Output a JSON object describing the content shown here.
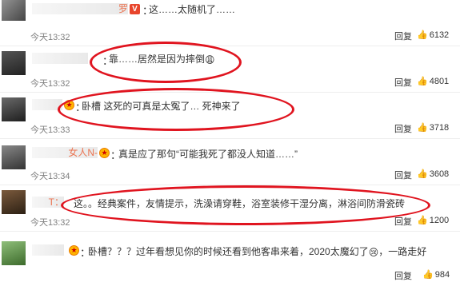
{
  "comments": [
    {
      "user": "罗",
      "text": "这……太随机了……",
      "time": "今天13:32",
      "reply": "回复",
      "likes": "6132"
    },
    {
      "user": "",
      "text": "靠……居然是因为摔倒",
      "time": "今天13:32",
      "reply": "回复",
      "likes": "4801"
    },
    {
      "user": "",
      "text": "卧槽 这死的可真是太冤了… 死神来了",
      "time": "今天13:33",
      "reply": "回复",
      "likes": "3718"
    },
    {
      "user": "女人N-",
      "text": "真是应了那句“可能我死了都没人知道……”",
      "time": "今天13:34",
      "reply": "回复",
      "likes": "3608"
    },
    {
      "user": "T：",
      "text": "这。。经典案件，友情提示，洗澡请穿鞋，浴室装修干湿分离，淋浴间防滑瓷砖",
      "time": "今天13:32",
      "reply": "回复",
      "likes": "1200"
    },
    {
      "user": "",
      "text": "卧槽？？？过年看想见你的时候还看到他客串来着，2020太魔幻了",
      "text_suffix": "一路走好",
      "time": "",
      "reply": "回复",
      "likes": "984"
    }
  ],
  "colors": {
    "highlight_circle": "#e0141f",
    "username": "#eb7350"
  },
  "icons": [
    "medal-icon",
    "vip-icon",
    "thumb-up-icon",
    "weary-emoji-icon",
    "crying-emoji-icon"
  ]
}
